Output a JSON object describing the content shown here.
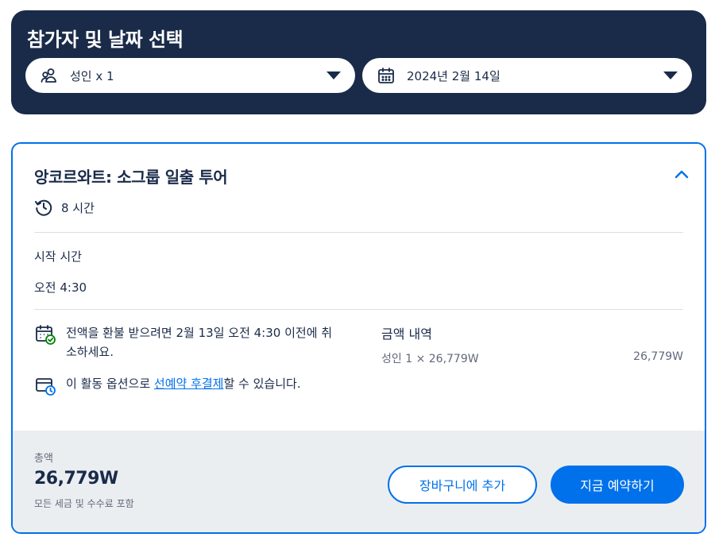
{
  "header": {
    "title": "참가자 및 날짜 선택",
    "participants_label": "성인 x 1",
    "date_label": "2024년 2월 14일",
    "participants_icon": "people-icon",
    "date_icon": "calendar-icon",
    "dropdown_icon": "caret-down-icon"
  },
  "option": {
    "title": "앙코르와트: 소그룹 일출 투어",
    "duration": "8 시간",
    "start_time_label": "시작 시간",
    "start_time_value": "오전 4:30",
    "policies": [
      {
        "icon": "calendar-check-icon",
        "text": "전액을 환불 받으려면 2월 13일 오전 4:30 이전에 취소하세요."
      },
      {
        "icon": "card-clock-icon",
        "text_before": "이 활동 옵션으로 ",
        "link": "선예약 후결제",
        "text_after": "할 수 있습니다."
      }
    ],
    "price_breakdown_title": "금액 내역",
    "price_line_label": "성인 1 × 26,779W",
    "price_line_value": "26,779W"
  },
  "footer": {
    "total_label": "총액",
    "total_value": "26,779W",
    "total_note": "모든 세금 및 수수료 포함",
    "cart_button": "장바구니에 추가",
    "book_button": "지금 예약하기"
  },
  "colors": {
    "navy": "#1a2b49",
    "accent": "#0071eb",
    "success": "#008009",
    "footer_bg": "#ebeef1"
  }
}
